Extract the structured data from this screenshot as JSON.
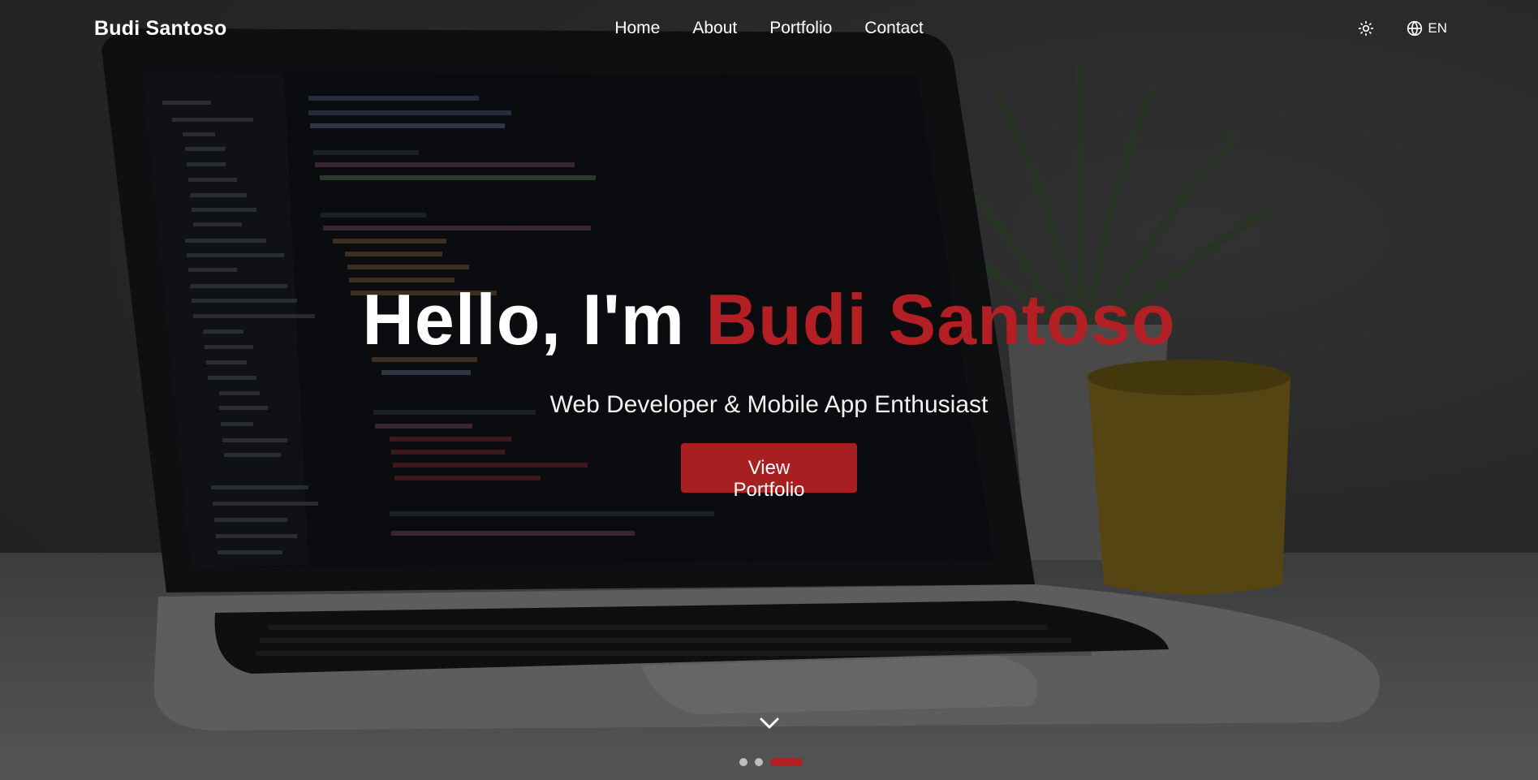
{
  "navbar": {
    "brand": "Budi Santoso",
    "links": [
      {
        "label": "Home"
      },
      {
        "label": "About"
      },
      {
        "label": "Portfolio"
      },
      {
        "label": "Contact"
      }
    ],
    "theme_icon": "sun-icon",
    "language_icon": "globe-icon",
    "language_label": "EN"
  },
  "hero": {
    "greeting": "Hello, I'm",
    "name": "Budi Santoso",
    "subtitle": "Web Developer & Mobile App Enthusiast",
    "cta_label": "View Portfolio",
    "scroll_icon": "chevron-down-icon"
  },
  "slider": {
    "total": 3,
    "active_index": 2
  },
  "colors": {
    "accent": "#b21f24",
    "button": "#a81f22",
    "text": "#ffffff"
  }
}
